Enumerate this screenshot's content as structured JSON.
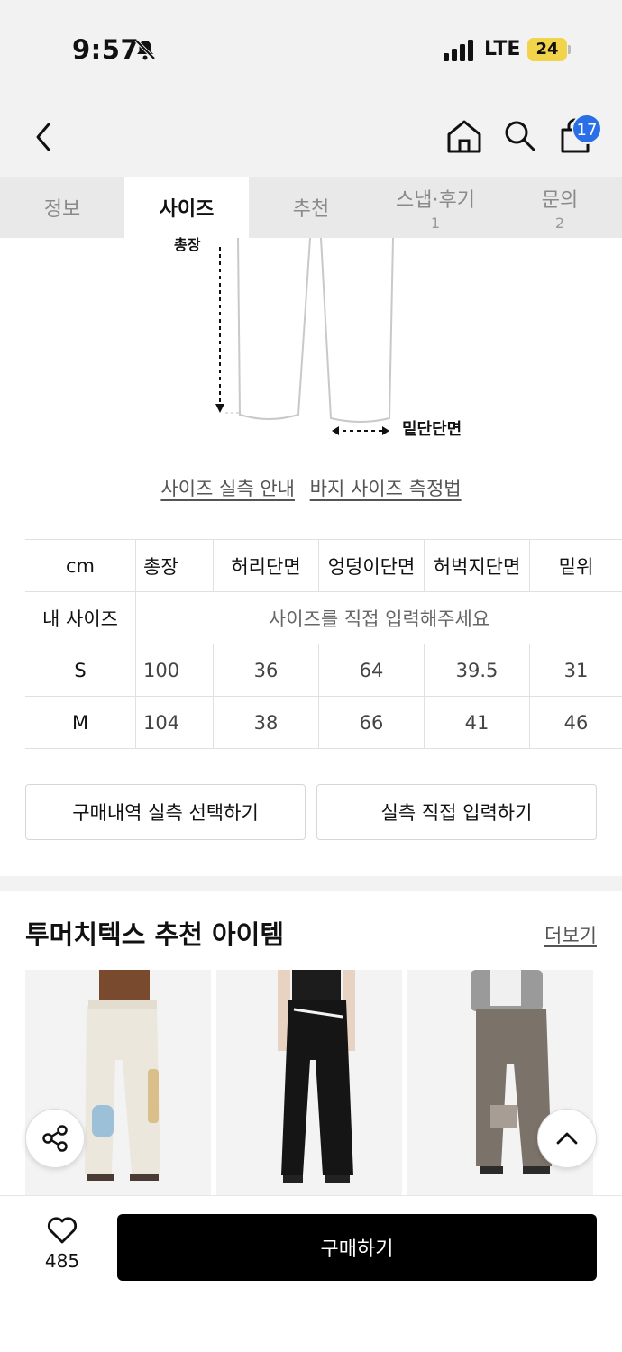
{
  "status": {
    "time": "9:57",
    "network": "LTE",
    "battery": "24"
  },
  "header": {
    "cart_count": "17"
  },
  "tabs": [
    {
      "label": "정보",
      "count": ""
    },
    {
      "label": "사이즈",
      "count": ""
    },
    {
      "label": "추천",
      "count": ""
    },
    {
      "label": "스냅·후기",
      "count": "1"
    },
    {
      "label": "문의",
      "count": "2"
    }
  ],
  "diagram": {
    "length_label": "총장",
    "hem_label": "밑단단면"
  },
  "guide_links": [
    "사이즈 실측 안내",
    "바지 사이즈 측정법"
  ],
  "size_table": {
    "headers": [
      "cm",
      "총장",
      "허리단면",
      "엉덩이단면",
      "허벅지단면",
      "밑위"
    ],
    "my_size_label": "내 사이즈",
    "my_size_placeholder": "사이즈를 직접 입력해주세요",
    "rows": [
      [
        "S",
        "100",
        "36",
        "64",
        "39.5",
        "31"
      ],
      [
        "M",
        "104",
        "38",
        "66",
        "41",
        "46"
      ]
    ]
  },
  "buttons": {
    "purchase_history": "구매내역 실측 선택하기",
    "manual_input": "실측 직접 입력하기"
  },
  "recommend": {
    "title": "투머치텍스 추천 아이템",
    "more": "더보기"
  },
  "bottom": {
    "likes": "485",
    "buy": "구매하기"
  }
}
